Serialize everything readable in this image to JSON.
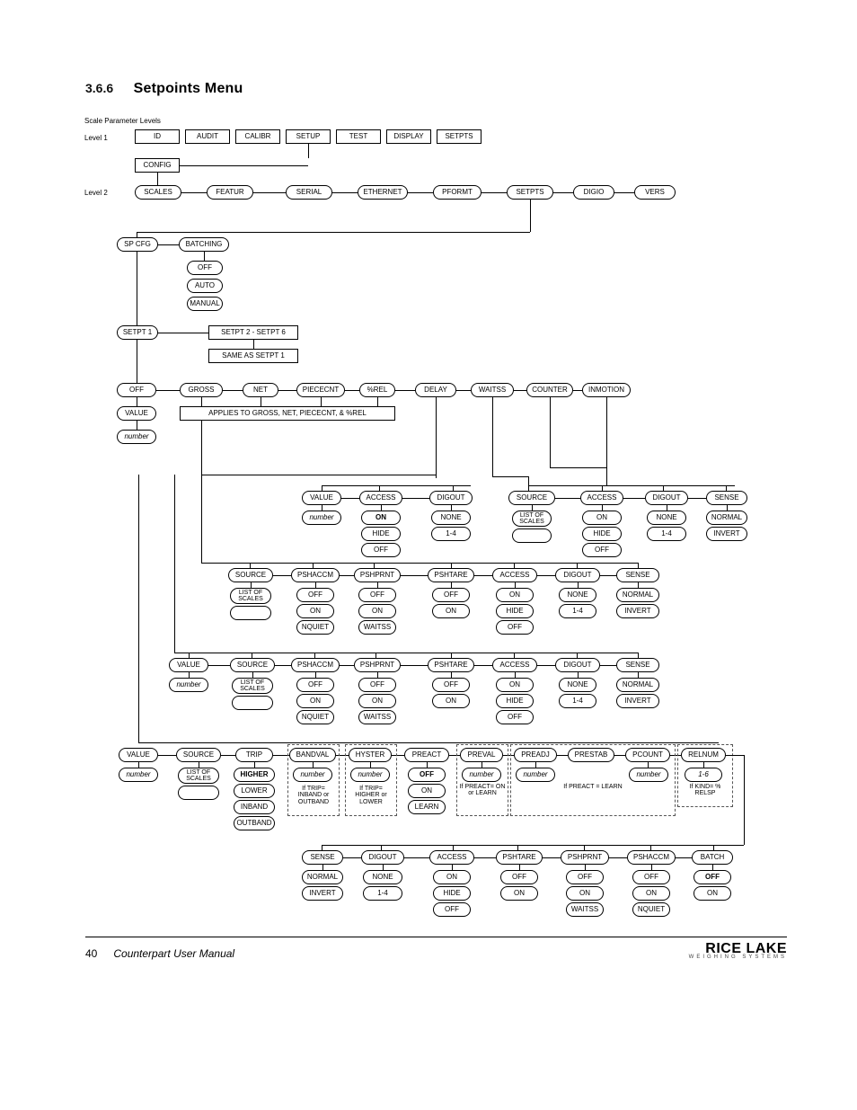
{
  "section": {
    "number": "3.6.6",
    "title": "Setpoints Menu"
  },
  "labels": {
    "scale_parameter_levels": "Scale Parameter Levels",
    "level1": "Level 1",
    "level2": "Level 2",
    "applies_note": "APPLIES TO GROSS, NET, PIECECNT, & %REL",
    "list_of_scales": "LIST OF SCALES",
    "number": "number",
    "if_trip_inband_outband": "If TRIP= INBAND or OUTBAND",
    "if_trip_higher_lower": "If TRIP= HIGHER or LOWER",
    "if_preact_on_learn": "If PREACT= ON or LEARN",
    "if_preact_learn": "If PREACT = LEARN",
    "if_kind_relsp": "If KIND= % RELSP"
  },
  "level1_items": [
    "ID",
    "AUDIT",
    "CALIBR",
    "SETUP",
    "TEST",
    "DISPLAY",
    "SETPTS"
  ],
  "level2_config": "CONFIG",
  "level2_items": [
    "SCALES",
    "FEATUR",
    "SERIAL",
    "ETHERNET",
    "PFORMT",
    "SETPTS",
    "DIGIO",
    "VERS"
  ],
  "spcfg": "SP CFG",
  "batching": {
    "title": "BATCHING",
    "options": [
      "OFF",
      "AUTO",
      "MANUAL"
    ]
  },
  "setpt": {
    "p1": "SETPT 1",
    "range": "SETPT 2 - SETPT 6",
    "same": "SAME AS SETPT 1"
  },
  "main_row": [
    "OFF",
    "GROSS",
    "NET",
    "PIECECNT",
    "%REL",
    "DELAY",
    "WAITSS",
    "COUNTER",
    "INMOTION"
  ],
  "value": "VALUE",
  "groupA": {
    "col1": {
      "head": "VALUE",
      "v": "number"
    },
    "col2": {
      "head": "ACCESS",
      "opts": [
        "ON",
        "HIDE",
        "OFF"
      ]
    },
    "col3": {
      "head": "DIGOUT",
      "opts": [
        "NONE",
        "1-4"
      ]
    },
    "col4": {
      "head": "SOURCE",
      "v": "LIST OF SCALES",
      "blank": ""
    },
    "col5": {
      "head": "ACCESS",
      "opts": [
        "ON",
        "HIDE",
        "OFF"
      ]
    },
    "col6": {
      "head": "DIGOUT",
      "opts": [
        "NONE",
        "1-4"
      ]
    },
    "col7": {
      "head": "SENSE",
      "opts": [
        "NORMAL",
        "INVERT"
      ]
    }
  },
  "groupB": {
    "cols": [
      {
        "head": "SOURCE",
        "opts": [
          "LIST OF SCALES",
          ""
        ]
      },
      {
        "head": "PSHACCM",
        "opts": [
          "OFF",
          "ON",
          "NQUIET"
        ]
      },
      {
        "head": "PSHPRNT",
        "opts": [
          "OFF",
          "ON",
          "WAITSS"
        ]
      },
      {
        "head": "PSHTARE",
        "opts": [
          "OFF",
          "ON"
        ]
      },
      {
        "head": "ACCESS",
        "opts": [
          "ON",
          "HIDE",
          "OFF"
        ]
      },
      {
        "head": "DIGOUT",
        "opts": [
          "NONE",
          "1-4"
        ]
      },
      {
        "head": "SENSE",
        "opts": [
          "NORMAL",
          "INVERT"
        ]
      }
    ]
  },
  "groupC": {
    "cols": [
      {
        "head": "VALUE",
        "opts": [
          "number"
        ]
      },
      {
        "head": "SOURCE",
        "opts": [
          "LIST OF SCALES",
          ""
        ]
      },
      {
        "head": "PSHACCM",
        "opts": [
          "OFF",
          "ON",
          "NQUIET"
        ]
      },
      {
        "head": "PSHPRNT",
        "opts": [
          "OFF",
          "ON",
          "WAITSS"
        ]
      },
      {
        "head": "PSHTARE",
        "opts": [
          "OFF",
          "ON"
        ]
      },
      {
        "head": "ACCESS",
        "opts": [
          "ON",
          "HIDE",
          "OFF"
        ]
      },
      {
        "head": "DIGOUT",
        "opts": [
          "NONE",
          "1-4"
        ]
      },
      {
        "head": "SENSE",
        "opts": [
          "NORMAL",
          "INVERT"
        ]
      }
    ]
  },
  "groupD": {
    "cols": [
      {
        "head": "VALUE",
        "opts": [
          "number"
        ]
      },
      {
        "head": "SOURCE",
        "opts": [
          "LIST OF SCALES",
          ""
        ]
      },
      {
        "head": "TRIP",
        "opts": [
          "HIGHER",
          "LOWER",
          "INBAND",
          "OUTBAND"
        ],
        "bold": 0
      },
      {
        "head": "BANDVAL",
        "opts": [
          "number"
        ]
      },
      {
        "head": "HYSTER",
        "opts": [
          "number"
        ]
      },
      {
        "head": "PREACT",
        "opts": [
          "OFF",
          "ON",
          "LEARN"
        ],
        "bold": 0
      },
      {
        "head": "PREVAL",
        "opts": [
          "number"
        ]
      },
      {
        "head": "PREADJ",
        "opts": [
          "number"
        ]
      },
      {
        "head": "PRESTAB"
      },
      {
        "head": "PCOUNT",
        "opts": [
          "number"
        ]
      },
      {
        "head": "RELNUM",
        "opts": [
          "1-6"
        ]
      }
    ]
  },
  "groupE": {
    "cols": [
      {
        "head": "SENSE",
        "opts": [
          "NORMAL",
          "INVERT"
        ]
      },
      {
        "head": "DIGOUT",
        "opts": [
          "NONE",
          "1-4"
        ]
      },
      {
        "head": "ACCESS",
        "opts": [
          "ON",
          "HIDE",
          "OFF"
        ]
      },
      {
        "head": "PSHTARE",
        "opts": [
          "OFF",
          "ON"
        ]
      },
      {
        "head": "PSHPRNT",
        "opts": [
          "OFF",
          "ON",
          "WAITSS"
        ]
      },
      {
        "head": "PSHACCM",
        "opts": [
          "OFF",
          "ON",
          "NQUIET"
        ]
      },
      {
        "head": "BATCH",
        "opts": [
          "OFF",
          "ON"
        ],
        "bold": 0
      }
    ]
  },
  "footer": {
    "page": "40",
    "title": "Counterpart User Manual",
    "brand": "RICE LAKE",
    "brand_sub": "WEIGHING SYSTEMS"
  }
}
